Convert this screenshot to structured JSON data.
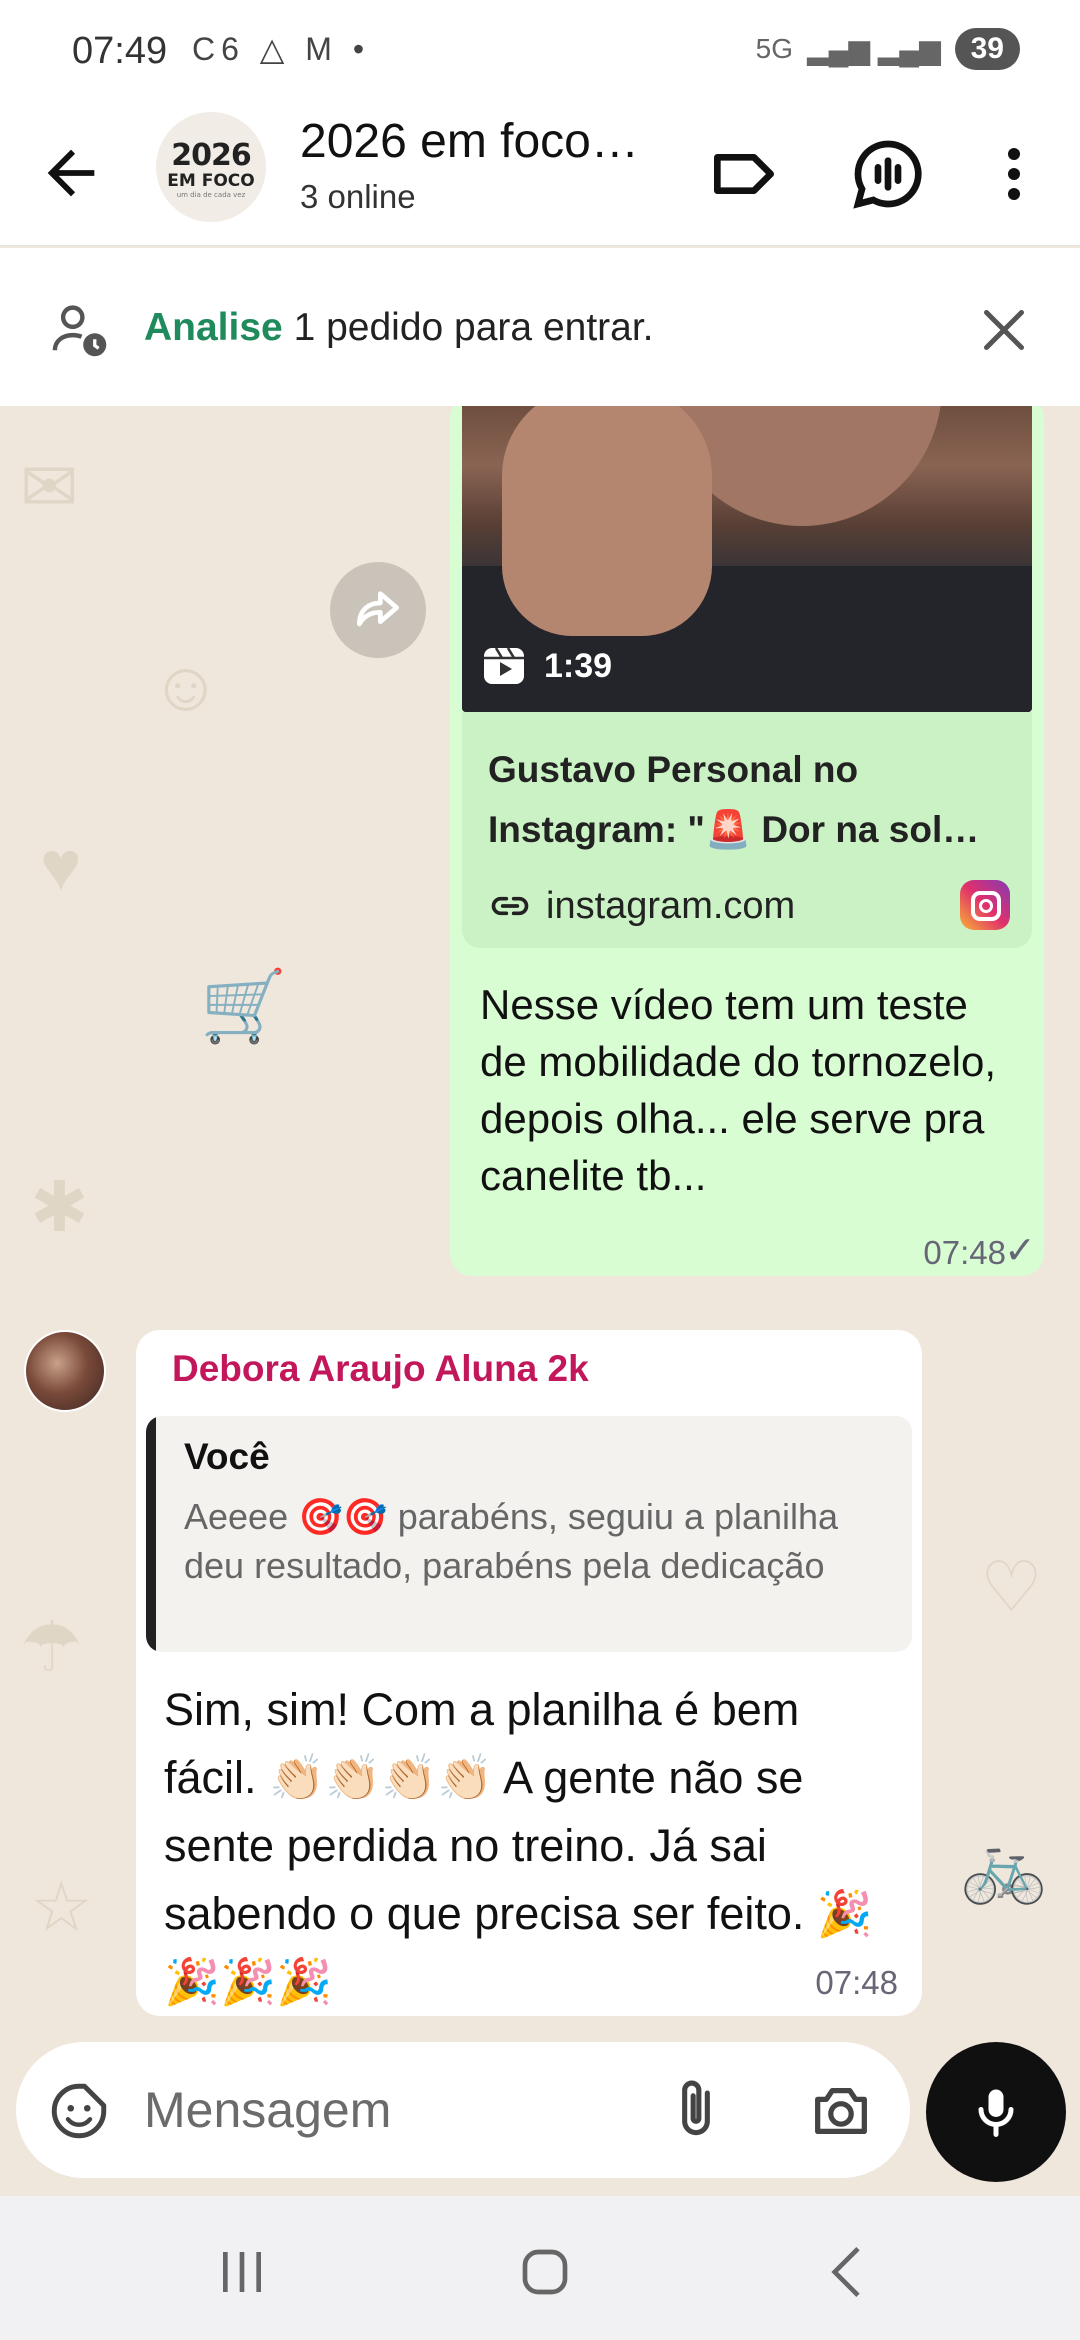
{
  "status_bar": {
    "time": "07:49",
    "left_icons": "C6 △ M •",
    "network": "5G",
    "battery": "39"
  },
  "header": {
    "avatar_line1": "2026",
    "avatar_line2": "EM FOCO",
    "avatar_line3": "um dia de cada vez",
    "title": "2026 em foco…",
    "subtitle": "3 online",
    "icons": [
      "back-arrow-icon",
      "label-tag-icon",
      "voice-chat-icon",
      "more-vert-icon"
    ]
  },
  "join_banner": {
    "action": "Analise",
    "text": " 1 pedido para entrar."
  },
  "messages": {
    "outgoing": {
      "video_duration": "1:39",
      "link_title": "Gustavo Personal no Instagram: \"🚨 Dor na sol…",
      "link_domain": "instagram.com",
      "text": "Nesse vídeo tem um teste de mobilidade do tornozelo, depois olha... ele serve pra canelite tb...",
      "time": "07:48",
      "status": "✓"
    },
    "incoming": {
      "sender": "Debora Araujo Aluna 2k",
      "quote_author": "Você",
      "quote_text": "Aeeee 🎯🎯 parabéns, seguiu a planilha deu resultado, parabéns pela dedicação",
      "text": "Sim, sim! Com a planilha é bem fácil. 👏🏻👏🏻👏🏻👏🏻 A gente não se sente perdida no treino. Já sai sabendo o que precisa ser feito. 🎉🎉🎉🎉",
      "time": "07:48"
    }
  },
  "composer": {
    "placeholder": "Mensagem"
  },
  "colors": {
    "accent_green": "#1f8a5b",
    "outgoing_bubble": "#d8fdd2",
    "sender_name": "#c2185b",
    "chat_background": "#efe7dc"
  }
}
